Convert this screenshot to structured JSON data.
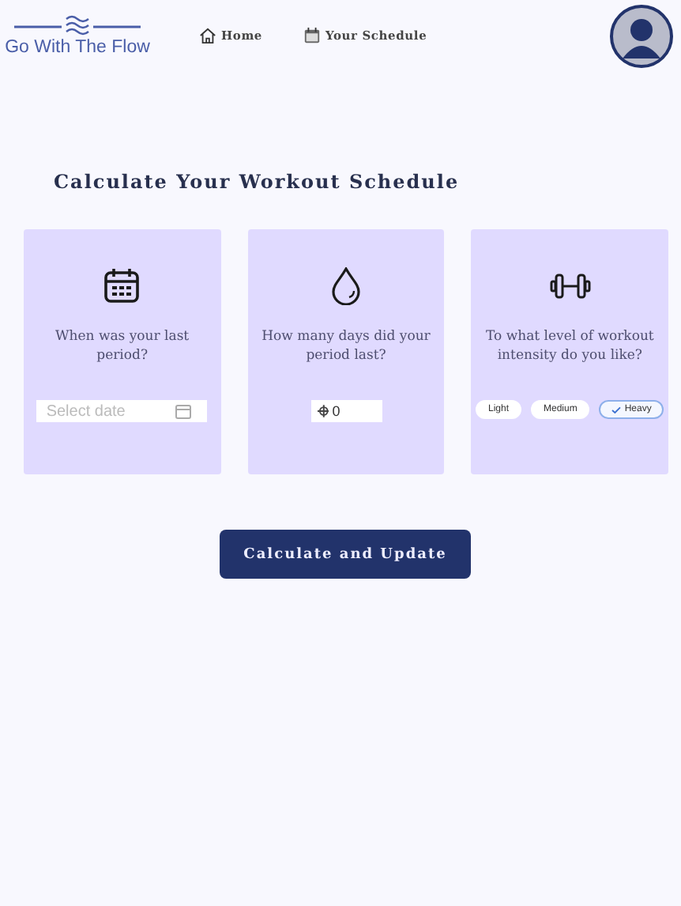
{
  "brand": "Go With The Flow",
  "nav": [
    {
      "label": "Home"
    },
    {
      "label": "Your Schedule"
    }
  ],
  "title": "Calculate Your Workout Schedule",
  "cards": [
    {
      "kind": "date",
      "question": "When was your last period?",
      "placeholder": "Select date"
    },
    {
      "kind": "number",
      "question": "How many days did your period last?",
      "value": "0"
    },
    {
      "kind": "choice",
      "question": "To what level of workout intensity do you like?",
      "options": [
        {
          "label": "Light",
          "selected": false
        },
        {
          "label": "Medium",
          "selected": false
        },
        {
          "label": "Heavy",
          "selected": true
        }
      ]
    }
  ],
  "button": "Calculate and Update"
}
